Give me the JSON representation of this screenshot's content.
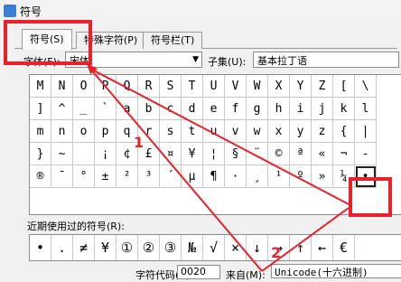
{
  "window": {
    "title": "符号"
  },
  "tabs": [
    {
      "label": "符号(S)"
    },
    {
      "label": "特殊字符(P)"
    },
    {
      "label": "符号栏(T)"
    }
  ],
  "font": {
    "label": "字体(F):",
    "value": "宋体"
  },
  "subset": {
    "label": "子集(U):",
    "value": "基本拉丁语"
  },
  "symbols": [
    "M",
    "N",
    "O",
    "P",
    "Q",
    "R",
    "S",
    "T",
    "U",
    "V",
    "W",
    "X",
    "Y",
    "Z",
    "[",
    "\\",
    "]",
    "^",
    "_",
    "`",
    "a",
    "b",
    "c",
    "d",
    "e",
    "f",
    "g",
    "h",
    "i",
    "j",
    "k",
    "l",
    "m",
    "n",
    "o",
    "p",
    "q",
    "r",
    "s",
    "t",
    "u",
    "v",
    "w",
    "x",
    "y",
    "z",
    "{",
    "|",
    "}",
    "~",
    "",
    "¡",
    "¢",
    "£",
    "¤",
    "¥",
    "¦",
    "§",
    "¨",
    "©",
    "ª",
    "«",
    "¬",
    "-",
    "®",
    "¯",
    "°",
    "±",
    "²",
    "³",
    "´",
    "µ",
    "¶",
    "·",
    "¸",
    "¹",
    "º",
    "»",
    "¼",
    "•"
  ],
  "selected_index": 79,
  "recent": {
    "label": "近期使用过的符号(R):",
    "symbols": [
      "•",
      ".",
      "≠",
      "¥",
      "①",
      "②",
      "③",
      "№",
      "√",
      "×",
      "↓",
      "→",
      "↑",
      "←",
      "€"
    ]
  },
  "code": {
    "label": "字符代码(C):",
    "value": "0020"
  },
  "from": {
    "label": "来自(M):",
    "value": "Unicode(十六进制)"
  },
  "annotations": [
    {
      "text": "1"
    },
    {
      "text": "2"
    }
  ],
  "colors": {
    "annotation": "#e8212b",
    "background": "#f0f0f0"
  }
}
